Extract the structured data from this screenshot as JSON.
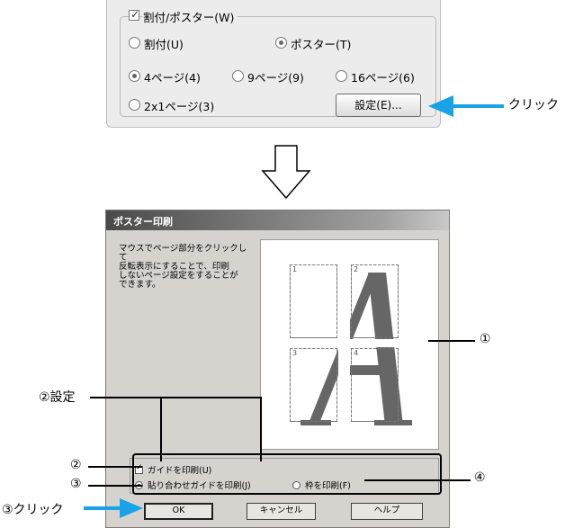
{
  "top_panel": {
    "group_label": "割付/ポスター(W)",
    "group_checked": true,
    "radio_warifu": "割付(U)",
    "radio_poster": "ポスター(T)",
    "page_4": "4ページ(4)",
    "page_9": "9ページ(9)",
    "page_16": "16ページ(6)",
    "page_2x1": "2x1ページ(3)",
    "settings_button": "設定(E)...",
    "click_label": "クリック"
  },
  "dialog": {
    "title": "ポスター印刷",
    "instructions": "マウスでページ部分をクリックして\n反転表示にすることで、印刷\nしないページ設定をすることが\nできます。",
    "pages": [
      "1",
      "2",
      "3",
      "4"
    ],
    "guide_checkbox": "ガイドを印刷(U)",
    "guide_checked": true,
    "radio_align_guide": "貼り合わせガイドを印刷(J)",
    "radio_frame": "枠を印刷(F)",
    "ok": "OK",
    "cancel": "キャンセル",
    "help": "ヘルプ"
  },
  "annotations": {
    "marker_1": "①",
    "marker_2_settings": "②設定",
    "marker_2": "②",
    "marker_3": "③",
    "marker_4": "④",
    "marker_3_click": "③クリック"
  },
  "colors": {
    "arrow_blue": "#19a3e6",
    "panel_bg": "#ececec",
    "dialog_bg": "#d6d3ce",
    "poster_letter": "#666666"
  }
}
